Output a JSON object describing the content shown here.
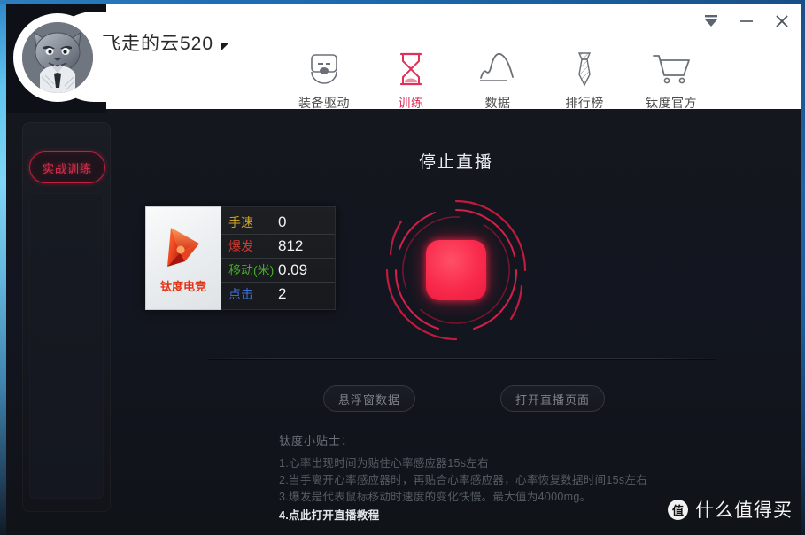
{
  "window": {
    "controls": [
      {
        "name": "collapse",
        "glyph": "collapse-arrow-icon"
      },
      {
        "name": "minimize",
        "glyph": "minimize-icon"
      },
      {
        "name": "close",
        "glyph": "close-icon"
      }
    ]
  },
  "header": {
    "username": "飞走的云520",
    "avatar_alt": "cat-in-suit-avatar",
    "nav": [
      {
        "label": "装备驱动",
        "icon": "mouse-device-icon",
        "active": false
      },
      {
        "label": "训练",
        "icon": "hourglass-icon",
        "active": true
      },
      {
        "label": "数据",
        "icon": "line-chart-icon",
        "active": false
      },
      {
        "label": "排行榜",
        "icon": "necktie-icon",
        "active": false
      },
      {
        "label": "钛度官方",
        "icon": "shopping-cart-icon",
        "active": false
      }
    ]
  },
  "sidebar": {
    "items": [
      {
        "label": "实战训练",
        "active": true
      }
    ]
  },
  "stats_card": {
    "logo_text": "钛度电竞",
    "rows": [
      {
        "label": "手速",
        "value": "0",
        "color": "#c9a227"
      },
      {
        "label": "爆发",
        "value": "812",
        "color": "#d6392c"
      },
      {
        "label": "移动(米)",
        "value": "0.09",
        "color": "#4aa832"
      },
      {
        "label": "点击",
        "value": "2",
        "color": "#3c6fd4"
      }
    ]
  },
  "live": {
    "title": "停止直播",
    "button_name": "stop-live-button",
    "accent": "#f5294a"
  },
  "actions": [
    {
      "label": "悬浮窗数据"
    },
    {
      "label": "打开直播页面"
    }
  ],
  "tips": {
    "heading": "钛度小贴士：",
    "lines": [
      "1.心率出现时间为贴住心率感应器15s左右",
      "2.当手离开心率感应器时，再贴合心率感应器，心率恢复数据时间15s左右",
      "3.爆发是代表鼠标移动时速度的变化快慢。最大值为4000mg。"
    ],
    "link": "4.点此打开直播教程"
  },
  "watermark": {
    "badge": "值",
    "text": "什么值得买"
  }
}
